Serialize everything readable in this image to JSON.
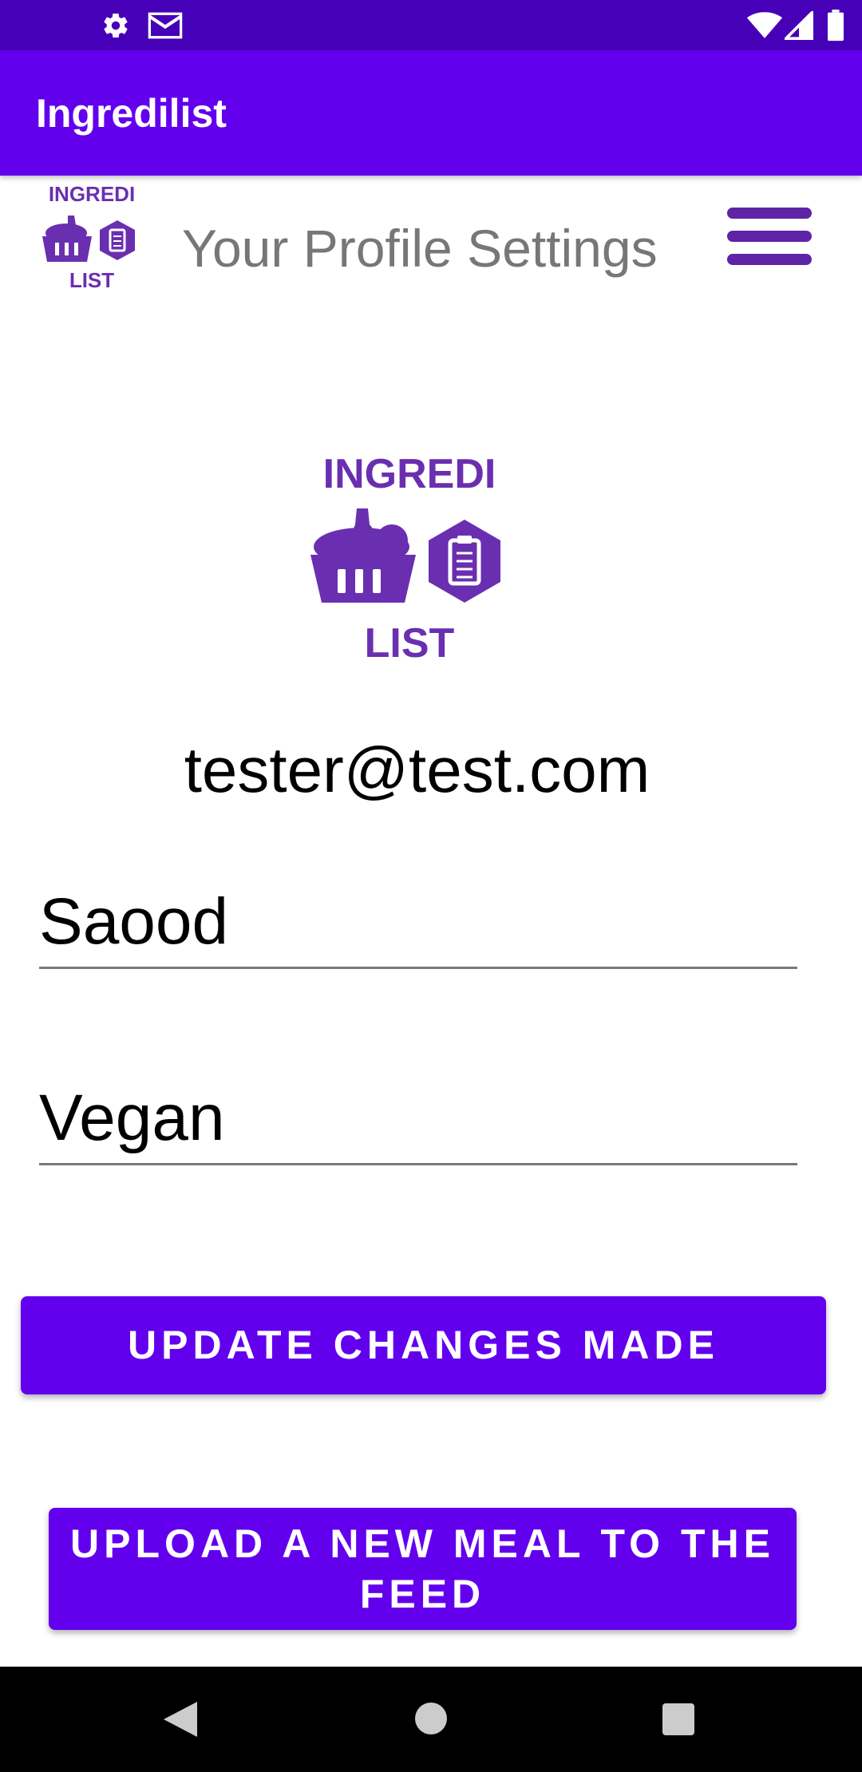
{
  "status_bar": {
    "left_icons": [
      "gear-icon",
      "mail-icon"
    ],
    "right_icons": [
      "wifi-icon",
      "signal-icon",
      "battery-icon"
    ]
  },
  "app_bar": {
    "title": "Ingredilist"
  },
  "header": {
    "logo_text_top": "INGREDI",
    "logo_text_bottom": "LIST",
    "title": "Your Profile Settings",
    "menu_icon": "hamburger-menu-icon"
  },
  "profile": {
    "logo_text_top": "INGREDI",
    "logo_text_bottom": "LIST",
    "email": "tester@test.com",
    "name_value": "Saood",
    "diet_value": "Vegan"
  },
  "buttons": {
    "update_label": "UPDATE CHANGES MADE",
    "upload_label": "UPLOAD A NEW MEAL TO THE FEED"
  },
  "nav_bar": {
    "back_icon": "back-triangle-icon",
    "home_icon": "home-circle-icon",
    "recents_icon": "recents-square-icon"
  },
  "colors": {
    "primary": "#6200ee",
    "primary_dark": "#4600b8",
    "logo_purple": "#6a2fb0",
    "menu_purple": "#5e23a7"
  }
}
